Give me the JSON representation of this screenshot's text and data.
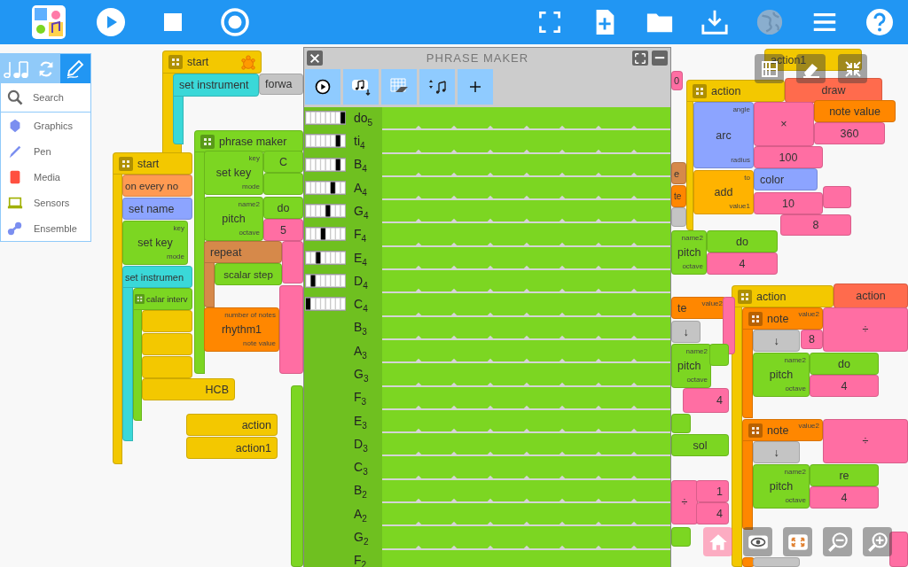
{
  "toolbar": {
    "left": [
      {
        "kind": "logo",
        "disabled": false
      },
      {
        "kind": "play",
        "disabled": false
      },
      {
        "kind": "stop",
        "disabled": false
      },
      {
        "kind": "record",
        "disabled": false
      }
    ],
    "right": [
      {
        "kind": "fullscreen",
        "disabled": false
      },
      {
        "kind": "new",
        "disabled": false
      },
      {
        "kind": "open",
        "disabled": false
      },
      {
        "kind": "save",
        "disabled": false
      },
      {
        "kind": "globe",
        "disabled": true
      },
      {
        "kind": "menu",
        "disabled": false
      },
      {
        "kind": "help",
        "disabled": false
      }
    ]
  },
  "palette": {
    "tabs": [
      {
        "kind": "rhythm",
        "selected": false
      },
      {
        "kind": "refresh",
        "selected": false
      },
      {
        "kind": "pen",
        "selected": true
      }
    ],
    "search": {
      "placeholder": "Search"
    },
    "items": [
      {
        "kind": "graphics",
        "label": "Graphics"
      },
      {
        "kind": "pen",
        "label": "Pen"
      },
      {
        "kind": "media",
        "label": "Media"
      },
      {
        "kind": "sensors",
        "label": "Sensors"
      },
      {
        "kind": "ensemble",
        "label": "Ensemble"
      }
    ]
  },
  "blocks": [
    {
      "kind": "control",
      "text": "start",
      "handle": true
    },
    {
      "kind": "tone",
      "text": "set instrument",
      "handle": false
    },
    {
      "kind": "gray",
      "text": "forwa",
      "handle": false
    },
    {
      "kind": "green",
      "text": "phrase maker",
      "handle": true
    },
    {
      "kind": "control",
      "text": "start",
      "handle": true
    },
    {
      "kind": "green",
      "text": "set key",
      "handle": false,
      "ports": [
        "key",
        "mode"
      ]
    },
    {
      "kind": "green",
      "text": "C",
      "handle": false
    },
    {
      "kind": "green",
      "handle": false
    },
    {
      "kind": "event",
      "text": "on every no",
      "handle": false
    },
    {
      "kind": "blue",
      "text": "set name",
      "handle": false
    },
    {
      "kind": "green",
      "text": "pitch",
      "handle": false,
      "ports": [
        "name2",
        "octave"
      ]
    },
    {
      "kind": "green",
      "text": "do",
      "handle": false
    },
    {
      "kind": "green",
      "text": "set key",
      "handle": false,
      "ports": [
        "key",
        "mode"
      ]
    },
    {
      "kind": "pink",
      "text": "5",
      "handle": false
    },
    {
      "kind": "brown",
      "text": "repeat",
      "handle": false
    },
    {
      "kind": "pink",
      "handle": false
    },
    {
      "kind": "tone",
      "text": "set instrumen",
      "handle": false
    },
    {
      "kind": "green",
      "text": "scalar step",
      "handle": false
    },
    {
      "kind": "pink",
      "handle": false
    },
    {
      "kind": "green",
      "text": "calar interv",
      "handle": true
    },
    {
      "kind": "orange",
      "text": "rhythm1",
      "handle": false,
      "ports": [
        "number of notes",
        "note value"
      ]
    },
    {
      "kind": "control",
      "handle": false
    },
    {
      "kind": "control",
      "handle": false
    },
    {
      "kind": "control",
      "handle": false
    },
    {
      "kind": "control",
      "text": "HCB",
      "handle": false
    },
    {
      "kind": "green",
      "handle": false
    },
    {
      "kind": "control",
      "text": "action",
      "handle": false
    },
    {
      "kind": "control",
      "text": "action1",
      "handle": false
    },
    {
      "kind": "control",
      "text": "action1",
      "handle": false
    },
    {
      "kind": "pink",
      "text": "0",
      "handle": false
    },
    {
      "kind": "control",
      "text": "action",
      "handle": true
    },
    {
      "kind": "red",
      "text": "draw",
      "handle": false
    },
    {
      "kind": "blue",
      "text": "arc",
      "handle": false,
      "ports": [
        "angle",
        "radius"
      ]
    },
    {
      "kind": "pink",
      "text": "×",
      "handle": false
    },
    {
      "kind": "orange",
      "text": "note value",
      "handle": false
    },
    {
      "kind": "pink",
      "text": "360",
      "handle": false
    },
    {
      "kind": "pink",
      "text": "100",
      "handle": false
    },
    {
      "kind": "brown",
      "text": "e",
      "handle": false
    },
    {
      "kind": "orange",
      "text": "te",
      "handle": false
    },
    {
      "kind": "amber",
      "text": "add",
      "handle": false,
      "ports": [
        "to",
        "value1"
      ]
    },
    {
      "kind": "blue",
      "text": "color",
      "handle": false
    },
    {
      "kind": "pink",
      "text": "10",
      "handle": false
    },
    {
      "kind": "pink",
      "handle": false
    },
    {
      "kind": "gray",
      "handle": false
    },
    {
      "kind": "pink",
      "text": "8",
      "handle": false
    },
    {
      "kind": "green",
      "text": "pitch",
      "handle": false,
      "ports": [
        "name2",
        "octave"
      ]
    },
    {
      "kind": "green",
      "text": "do",
      "handle": false
    },
    {
      "kind": "pink",
      "text": "4",
      "handle": false
    },
    {
      "kind": "control",
      "text": "action",
      "handle": true
    },
    {
      "kind": "red",
      "text": "action",
      "handle": false
    },
    {
      "kind": "orange",
      "text": "te",
      "handle": false,
      "ports": [
        "value2"
      ]
    },
    {
      "kind": "pink",
      "handle": false
    },
    {
      "kind": "orange",
      "text": "note",
      "handle": true,
      "ports": [
        "value2"
      ]
    },
    {
      "kind": "pink",
      "text": "÷",
      "handle": false
    },
    {
      "kind": "gray",
      "text": "↓",
      "handle": false
    },
    {
      "kind": "gray",
      "text": "↓",
      "handle": false
    },
    {
      "kind": "pink",
      "text": "8",
      "handle": false
    },
    {
      "kind": "green",
      "text": "pitch",
      "handle": false,
      "ports": [
        "name2",
        "octave"
      ]
    },
    {
      "kind": "green",
      "handle": false
    },
    {
      "kind": "green",
      "text": "pitch",
      "handle": false,
      "ports": [
        "name2",
        "octave"
      ]
    },
    {
      "kind": "green",
      "text": "do",
      "handle": false
    },
    {
      "kind": "pink",
      "text": "4",
      "handle": false
    },
    {
      "kind": "pink",
      "text": "4",
      "handle": false
    },
    {
      "kind": "green",
      "handle": false
    },
    {
      "kind": "orange",
      "text": "note",
      "handle": true,
      "ports": [
        "value2"
      ]
    },
    {
      "kind": "pink",
      "text": "÷",
      "handle": false
    },
    {
      "kind": "green",
      "text": "sol",
      "handle": false
    },
    {
      "kind": "gray",
      "text": "↓",
      "handle": false
    },
    {
      "kind": "green",
      "text": "pitch",
      "handle": false,
      "ports": [
        "name2",
        "octave"
      ]
    },
    {
      "kind": "green",
      "text": "re",
      "handle": false
    },
    {
      "kind": "pink",
      "text": "÷",
      "handle": false
    },
    {
      "kind": "pink",
      "text": "1",
      "handle": false
    },
    {
      "kind": "pink",
      "text": "4",
      "handle": false
    },
    {
      "kind": "pink",
      "text": "4",
      "handle": false
    },
    {
      "kind": "green",
      "handle": false
    },
    {
      "kind": "orange",
      "handle": false
    },
    {
      "kind": "pink",
      "handle": false
    },
    {
      "kind": "gray",
      "handle": false
    }
  ],
  "canvas_tools": {
    "top": [
      {
        "kind": "grid"
      },
      {
        "kind": "eraser"
      },
      {
        "kind": "collapse"
      }
    ],
    "bottom": [
      {
        "kind": "home"
      },
      {
        "kind": "eye"
      },
      {
        "kind": "expand"
      },
      {
        "kind": "zoom-out"
      },
      {
        "kind": "zoom-in"
      }
    ]
  },
  "phrase_maker": {
    "title": "PHRASE MAKER",
    "tools": [
      {
        "kind": "play"
      },
      {
        "kind": "save"
      },
      {
        "kind": "erase"
      },
      {
        "kind": "sort"
      },
      {
        "kind": "add"
      }
    ],
    "rows": [
      {
        "note": "do$_{5}$",
        "level": 1
      },
      {
        "note": "ti$_{4}$",
        "level": 0.86
      },
      {
        "note": "B$_{4}$",
        "level": 0.86
      },
      {
        "note": "A$_{4}$",
        "level": 0.71
      },
      {
        "note": "G$_{4}$",
        "level": 0.57
      },
      {
        "note": "F$_{4}$",
        "level": 0.43
      },
      {
        "note": "E$_{4}$",
        "level": 0.29
      },
      {
        "note": "D$_{4}$",
        "level": 0.14
      },
      {
        "note": "C$_{4}$",
        "level": 0
      },
      {
        "note": "B$_{3}$"
      },
      {
        "note": "A$_{3}$"
      },
      {
        "note": "G$_{3}$"
      },
      {
        "note": "F$_{3}$"
      },
      {
        "note": "E$_{3}$"
      },
      {
        "note": "D$_{3}$"
      },
      {
        "note": "C$_{3}$"
      },
      {
        "note": "B$_{2}$"
      },
      {
        "note": "A$_{2}$"
      },
      {
        "note": "G$_{2}$"
      },
      {
        "note": "F$_{2}$"
      }
    ]
  }
}
